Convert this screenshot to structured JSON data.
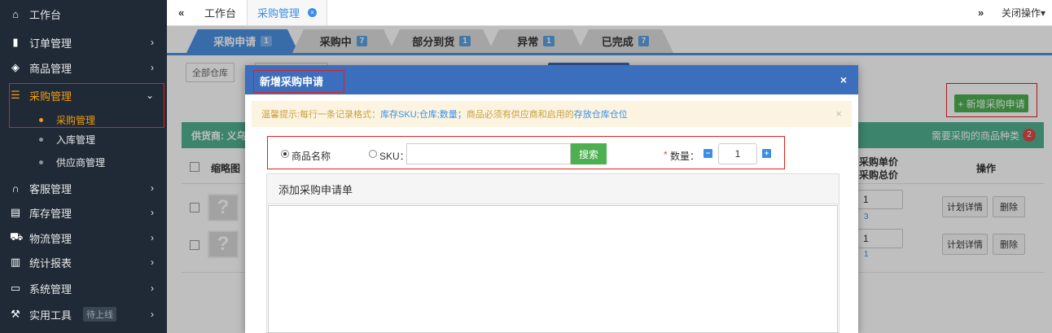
{
  "sidebar": {
    "items": [
      {
        "label": "工作台",
        "icon": "home-icon",
        "glyph": "⌂",
        "arrow": ""
      },
      {
        "label": "订单管理",
        "icon": "order-icon",
        "glyph": "▮",
        "arrow": "›"
      },
      {
        "label": "商品管理",
        "icon": "cube-icon",
        "glyph": "◈",
        "arrow": "›"
      },
      {
        "label": "采购管理",
        "icon": "cart-icon",
        "glyph": "☰",
        "arrow": "⌄"
      },
      {
        "label": "客服管理",
        "icon": "headset-icon",
        "glyph": "∩",
        "arrow": "›"
      },
      {
        "label": "库存管理",
        "icon": "inventory-icon",
        "glyph": "▤",
        "arrow": "›"
      },
      {
        "label": "物流管理",
        "icon": "truck-icon",
        "glyph": "⛟",
        "arrow": "›"
      },
      {
        "label": "统计报表",
        "icon": "report-icon",
        "glyph": "▥",
        "arrow": "›"
      },
      {
        "label": "系统管理",
        "icon": "monitor-icon",
        "glyph": "▭",
        "arrow": "›"
      },
      {
        "label": "实用工具",
        "icon": "wrench-icon",
        "glyph": "⚒",
        "arrow": "›",
        "badge": "待上线"
      }
    ],
    "sub_items": [
      {
        "label": "采购管理"
      },
      {
        "label": "入库管理"
      },
      {
        "label": "供应商管理"
      }
    ]
  },
  "topbar": {
    "back_glyph": "«",
    "tabs": [
      {
        "label": "工作台"
      },
      {
        "label": "采购管理"
      }
    ],
    "close_glyph": "×",
    "forward_glyph": "»",
    "close_ops_label": "关闭操作▾"
  },
  "status_tabs": [
    {
      "label": "采购申请",
      "count": "1"
    },
    {
      "label": "采购中",
      "count": "7"
    },
    {
      "label": "部分到货",
      "count": "1"
    },
    {
      "label": "异常",
      "count": "1"
    },
    {
      "label": "已完成",
      "count": "7"
    }
  ],
  "filters": {
    "all_warehouses": "全部仓库"
  },
  "add_purchase_button": "+ 新增采购申请",
  "supplier_bar": {
    "supplier_label": "供货商: 义乌",
    "need_label": "需要采购的商品种类",
    "need_count": "2"
  },
  "table": {
    "headers": {
      "thumbnail": "缩略图",
      "unit_price": "采购单价",
      "total_price": "采购总价",
      "actions": "操作"
    },
    "rows": [
      {
        "placeholder": "?",
        "qty": "1",
        "total": "3",
        "detail_btn": "计划详情",
        "delete_btn": "删除"
      },
      {
        "placeholder": "?",
        "qty": "1",
        "total": "1",
        "detail_btn": "计划详情",
        "delete_btn": "删除"
      }
    ]
  },
  "modal": {
    "title": "新增采购申请",
    "close_glyph": "×",
    "tip": {
      "prefix": "温馨提示:每行一条记录格式：",
      "format": "库存SKU;仓库;数量；",
      "middle": "商品必须有供应商和启用的",
      "suffix": "存放仓库仓位",
      "close_glyph": "×"
    },
    "search": {
      "option_name": "商品名称",
      "option_sku": "SKU：",
      "sku_value": "",
      "search_button": "搜索",
      "required_mark": "*",
      "qty_label": "数量：",
      "minus": "−",
      "qty_value": "1",
      "plus": "+"
    },
    "panel": {
      "title": "添加采购申请单",
      "textarea_value": ""
    }
  }
}
